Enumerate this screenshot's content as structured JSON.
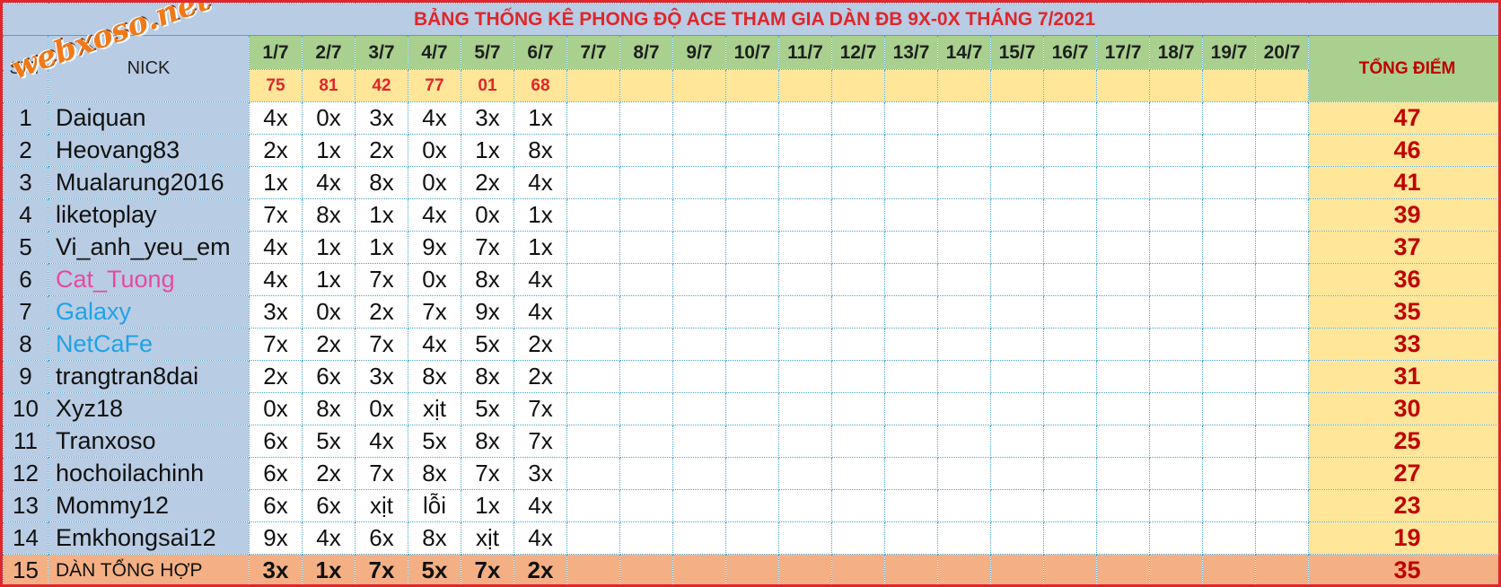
{
  "title": "BẢNG THỐNG KÊ PHONG ĐỘ ACE THAM GIA DÀN ĐB 9X-0X THÁNG 7/2021",
  "watermark": "webxoso.net",
  "headers": {
    "stt": "STT",
    "nick": "NICK",
    "total": "TỔNG ĐIỂM"
  },
  "dates": [
    "1/7",
    "2/7",
    "3/7",
    "4/7",
    "5/7",
    "6/7",
    "7/7",
    "8/7",
    "9/7",
    "10/7",
    "11/7",
    "12/7",
    "13/7",
    "14/7",
    "15/7",
    "16/7",
    "17/7",
    "18/7",
    "19/7",
    "20/7"
  ],
  "results": [
    "75",
    "81",
    "42",
    "77",
    "01",
    "68",
    "",
    "",
    "",
    "",
    "",
    "",
    "",
    "",
    "",
    "",
    "",
    "",
    "",
    ""
  ],
  "rows": [
    {
      "stt": "1",
      "nick": "Daiquan",
      "values": [
        "4x",
        "0x",
        "3x",
        "4x",
        "3x",
        "1x"
      ],
      "total": "47"
    },
    {
      "stt": "2",
      "nick": "Heovang83",
      "values": [
        "2x",
        "1x",
        "2x",
        "0x",
        "1x",
        "8x"
      ],
      "total": "46"
    },
    {
      "stt": "3",
      "nick": "Mualarung2016",
      "values": [
        "1x",
        "4x",
        "8x",
        "0x",
        "2x",
        "4x"
      ],
      "total": "41"
    },
    {
      "stt": "4",
      "nick": "liketoplay",
      "values": [
        "7x",
        "8x",
        "1x",
        "4x",
        "0x",
        "1x"
      ],
      "total": "39"
    },
    {
      "stt": "5",
      "nick": "Vi_anh_yeu_em",
      "values": [
        "4x",
        "1x",
        "1x",
        "9x",
        "7x",
        "1x"
      ],
      "total": "37"
    },
    {
      "stt": "6",
      "nick": "Cat_Tuong",
      "values": [
        "4x",
        "1x",
        "7x",
        "0x",
        "8x",
        "4x"
      ],
      "total": "36",
      "color": "#e64aa0"
    },
    {
      "stt": "7",
      "nick": "Galaxy",
      "values": [
        "3x",
        "0x",
        "2x",
        "7x",
        "9x",
        "4x"
      ],
      "total": "35",
      "color": "#1fa3e6"
    },
    {
      "stt": "8",
      "nick": "NetCaFe",
      "values": [
        "7x",
        "2x",
        "7x",
        "4x",
        "5x",
        "2x"
      ],
      "total": "33",
      "color": "#1fa3e6"
    },
    {
      "stt": "9",
      "nick": "trangtran8dai",
      "values": [
        "2x",
        "6x",
        "3x",
        "8x",
        "8x",
        "2x"
      ],
      "total": "31"
    },
    {
      "stt": "10",
      "nick": "Xyz18",
      "values": [
        "0x",
        "8x",
        "0x",
        "xịt",
        "5x",
        "7x"
      ],
      "total": "30"
    },
    {
      "stt": "11",
      "nick": "Tranxoso",
      "values": [
        "6x",
        "5x",
        "4x",
        "5x",
        "8x",
        "7x"
      ],
      "total": "25"
    },
    {
      "stt": "12",
      "nick": "hochoilachinh",
      "values": [
        "6x",
        "2x",
        "7x",
        "8x",
        "7x",
        "3x"
      ],
      "total": "27"
    },
    {
      "stt": "13",
      "nick": "Mommy12",
      "values": [
        "6x",
        "6x",
        "xịt",
        "lỗi",
        "1x",
        "4x"
      ],
      "total": "23"
    },
    {
      "stt": "14",
      "nick": "Emkhongsai12",
      "values": [
        "9x",
        "4x",
        "6x",
        "8x",
        "xịt",
        "4x"
      ],
      "total": "19"
    },
    {
      "stt": "15",
      "nick": "DÀN TỔNG HỢP",
      "values": [
        "3x",
        "1x",
        "7x",
        "5x",
        "7x",
        "2x"
      ],
      "total": "35",
      "summary": true
    }
  ],
  "colors": {
    "header_blue": "#b8cce4",
    "date_green": "#a9d08e",
    "result_yellow": "#ffe699",
    "summary_orange": "#f4b084",
    "accent_red": "#e0262a",
    "total_red": "#c00000"
  }
}
